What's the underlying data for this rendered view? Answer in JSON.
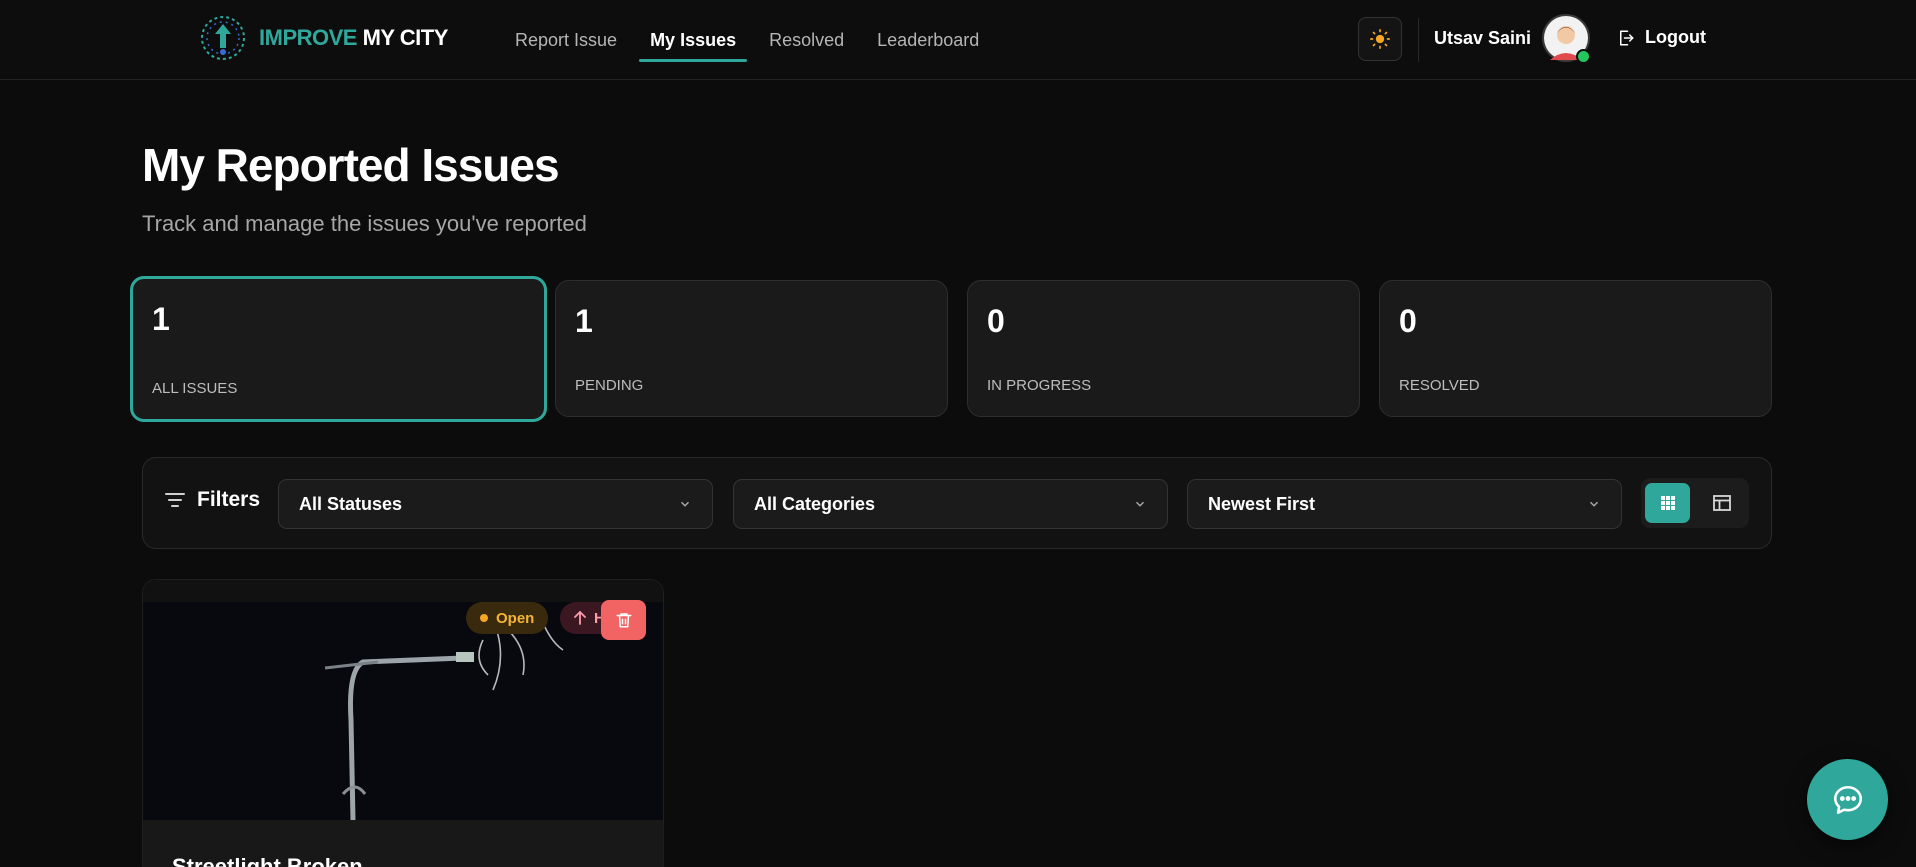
{
  "brand": {
    "name_part1": "IMPROVE",
    "name_part2": " MY CITY"
  },
  "nav": {
    "items": [
      {
        "label": "Report Issue"
      },
      {
        "label": "My Issues"
      },
      {
        "label": "Resolved"
      },
      {
        "label": "Leaderboard"
      }
    ],
    "active": "My Issues"
  },
  "user": {
    "name": "Utsav Saini",
    "logout_label": "Logout"
  },
  "page": {
    "title": "My Reported Issues",
    "subtitle": "Track and manage the issues you've reported"
  },
  "stats": [
    {
      "count": "1",
      "label": "ALL ISSUES"
    },
    {
      "count": "1",
      "label": "PENDING"
    },
    {
      "count": "0",
      "label": "IN PROGRESS"
    },
    {
      "count": "0",
      "label": "RESOLVED"
    }
  ],
  "filters": {
    "title": "Filters",
    "status_select": "All Statuses",
    "category_select": "All Categories",
    "sort_select": "Newest First"
  },
  "issue_card": {
    "title": "Streetlight Broken",
    "status_badge": "Open",
    "priority_badge": "H"
  },
  "colors": {
    "accent": "#2fa89b",
    "background": "#0c0c0c",
    "open_badge": "#f5b335",
    "delete": "#f26464",
    "online": "#22c55e"
  },
  "icons": [
    "sun-icon",
    "logout-icon",
    "filter-icon",
    "chevron-down-icon",
    "grid-icon",
    "table-icon",
    "arrow-up-icon",
    "trash-icon",
    "chat-icon"
  ]
}
